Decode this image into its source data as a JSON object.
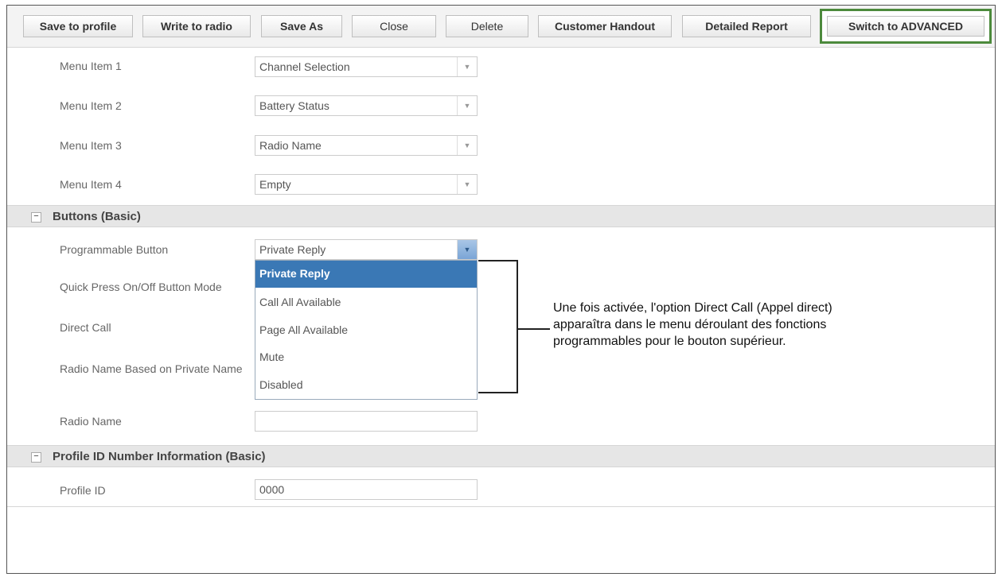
{
  "toolbar": {
    "buttons": [
      {
        "label": "Save to profile"
      },
      {
        "label": "Write to radio"
      },
      {
        "label": "Save As"
      },
      {
        "label": "Close"
      },
      {
        "label": "Delete"
      },
      {
        "label": "Customer Handout"
      },
      {
        "label": "Detailed Report"
      },
      {
        "label": "Switch to ADVANCED"
      }
    ]
  },
  "menu_items": [
    {
      "label": "Menu Item 1",
      "value": "Channel Selection"
    },
    {
      "label": "Menu Item 2",
      "value": "Battery Status"
    },
    {
      "label": "Menu Item 3",
      "value": "Radio Name"
    },
    {
      "label": "Menu Item 4",
      "value": "Empty"
    }
  ],
  "buttons_section": {
    "title": "Buttons (Basic)",
    "toggle": "−",
    "programmable_button": {
      "label": "Programmable Button",
      "value": "Private Reply"
    },
    "quick_press": {
      "label": "Quick Press On/Off Button Mode"
    },
    "direct_call": {
      "label": "Direct Call"
    },
    "radio_name_based": {
      "label": "Radio Name Based on Private Name"
    },
    "radio_name": {
      "label": "Radio Name",
      "value": ""
    },
    "dropdown_options": [
      "Private Reply",
      "Call All Available",
      "Page All Available",
      "Mute",
      "Disabled"
    ]
  },
  "profile_section": {
    "title": "Profile ID Number Information (Basic)",
    "toggle": "−",
    "profile_id": {
      "label": "Profile ID",
      "value": "0000"
    }
  },
  "annotation": "Une fois activée, l'option Direct Call (Appel direct) apparaîtra dans le menu déroulant des fonctions programmables pour le bouton supérieur.",
  "icons": {
    "dropdown_arrow": "▼"
  },
  "colors": {
    "accent_green": "#4c8a3c",
    "selected_blue": "#3a78b5"
  }
}
